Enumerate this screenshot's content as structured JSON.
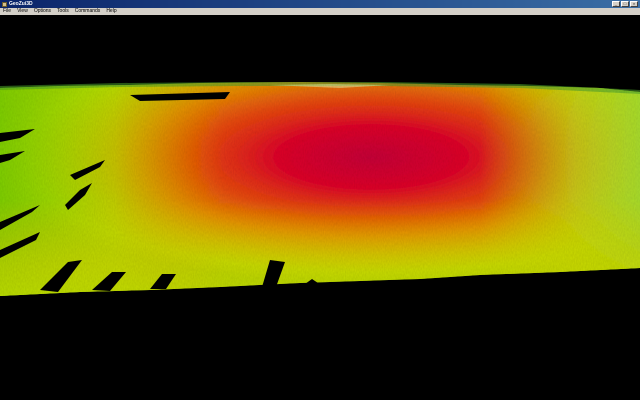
{
  "window": {
    "title": "GeoZui3D",
    "buttons": {
      "minimize_icon": "minimize-icon",
      "maximize_icon": "maximize-icon",
      "close_icon": "close-icon"
    }
  },
  "menubar": {
    "items": [
      "File",
      "View",
      "Options",
      "Tools",
      "Commands",
      "Help"
    ]
  },
  "viewport": {
    "content": "3D bathymetry terrain surface",
    "color_scale": [
      "#2a8a2a",
      "#b8e000",
      "#e8a000",
      "#e02000",
      "#d0003a"
    ]
  }
}
